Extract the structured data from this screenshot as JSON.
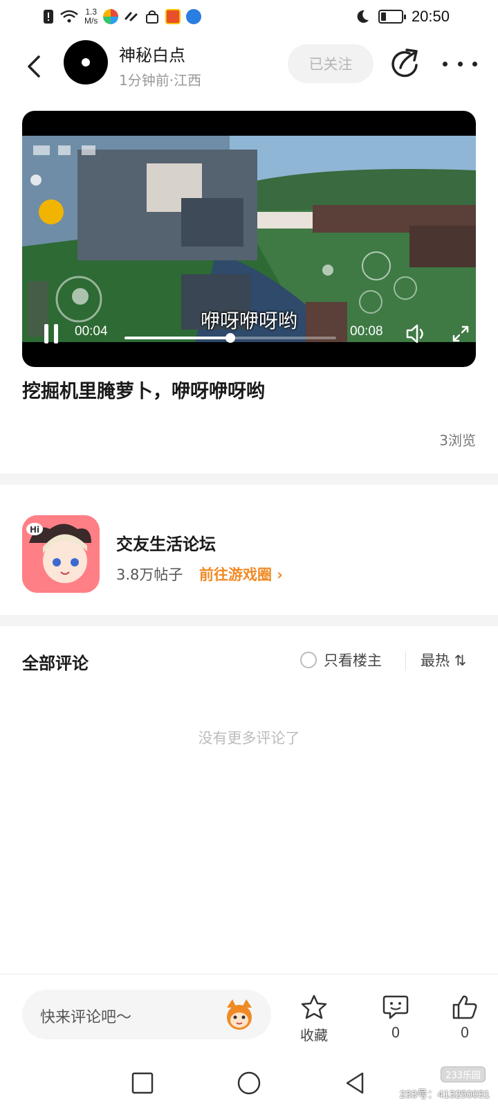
{
  "status_bar": {
    "net_speed_value": "1.3",
    "net_speed_unit": "M/s",
    "time": "20:50"
  },
  "header": {
    "author_name": "神秘白点",
    "post_meta": "1分钟前·江西",
    "follow_label": "已关注"
  },
  "video": {
    "subtitle": "咿呀咿呀哟",
    "current_time": "00:04",
    "total_time": "00:08",
    "progress": 0.5
  },
  "post": {
    "title": "挖掘机里腌萝卜，咿呀咿呀哟",
    "views": "3浏览"
  },
  "forum": {
    "name": "交友生活论坛",
    "posts": "3.8万帖子",
    "link_label": "前往游戏圈 ›"
  },
  "comments": {
    "title": "全部评论",
    "op_only_label": "只看楼主",
    "sort_label": "最热 ⇅",
    "empty_text": "没有更多评论了"
  },
  "bottom_bar": {
    "input_placeholder": "快来评论吧～",
    "favorite_label": "收藏",
    "comment_count": "0",
    "like_count": "0"
  },
  "watermark": {
    "logo": "233乐园",
    "text": "233号：413250031"
  },
  "colors": {
    "accent": "#f08a24",
    "follow_bg": "#f2f2f2",
    "divider": "#f4f4f4"
  }
}
